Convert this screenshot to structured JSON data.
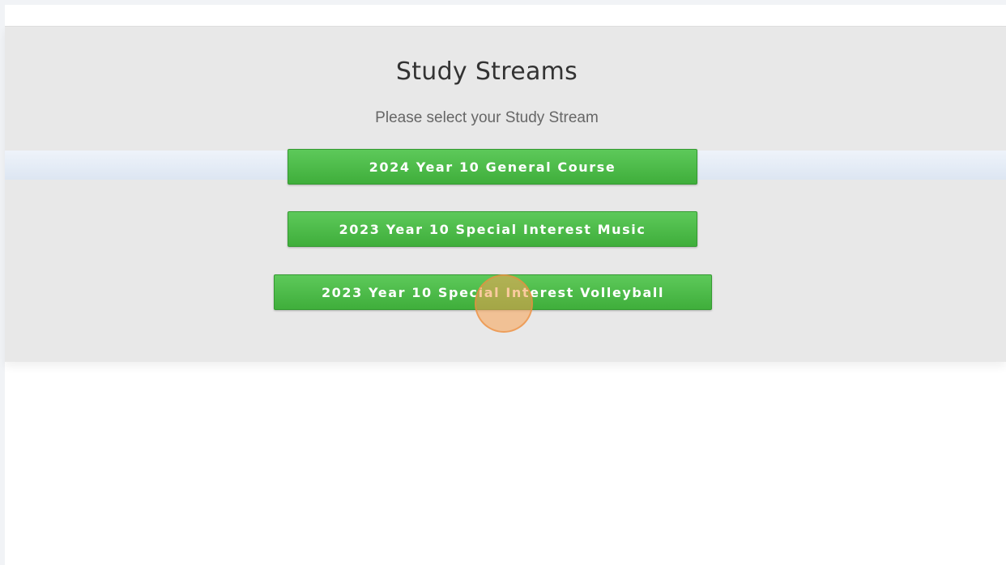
{
  "page": {
    "title": "Study Streams",
    "subtitle": "Please select your Study Stream"
  },
  "streams": [
    {
      "label": "2024 Year 10 General Course"
    },
    {
      "label": "2023 Year 10 Special Interest Music"
    },
    {
      "label": "2023 Year 10 Special Interest Volleyball"
    }
  ],
  "colors": {
    "button_green": "#4cbb49",
    "panel_gray": "#e8e8e8",
    "click_indicator": "#f7a050"
  }
}
